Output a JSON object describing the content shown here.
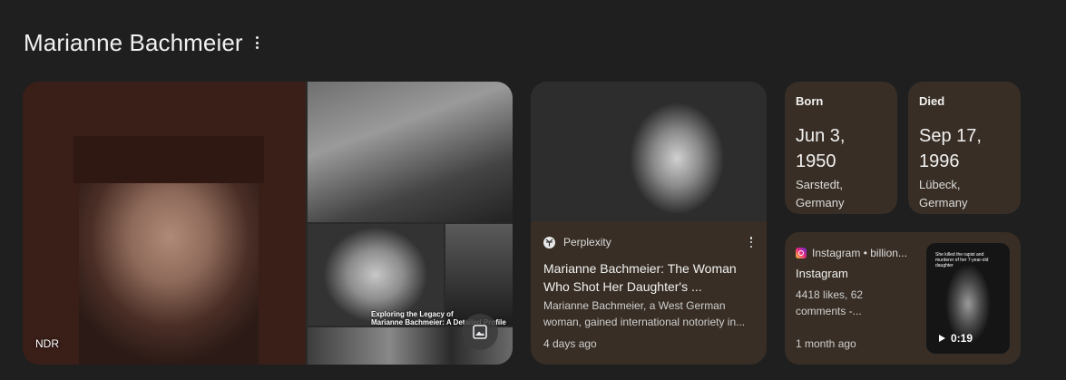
{
  "header": {
    "title": "Marianne Bachmeier"
  },
  "images": {
    "credit": "NDR",
    "overlay_caption_line1": "Exploring the Legacy of",
    "overlay_caption_line2": "Marianne Bachmeier: A Detailed Profile",
    "gallery_icon": "image-icon"
  },
  "article": {
    "source": "Perplexity",
    "title": "Marianne Bachmeier: The Woman Who Shot Her Daughter's ...",
    "snippet": "Marianne Bachmeier, a West German woman, gained international notoriety in...",
    "date": "4 days ago"
  },
  "facts": {
    "born": {
      "label": "Born",
      "date": "Jun 3, 1950",
      "place": "Sarstedt, Germany"
    },
    "died": {
      "label": "Died",
      "date": "Sep 17, 1996",
      "place": "Lübeck, Germany"
    }
  },
  "video": {
    "source": "Instagram • billion...",
    "title": "Instagram",
    "snippet": "4418 likes, 62 comments -...",
    "date": "1 month ago",
    "duration": "0:19",
    "thumb_caption": "She killed the rapist and murderer of her 7-year-old daughter"
  },
  "colors": {
    "background": "#1f1f1f",
    "card": "#382e25"
  }
}
